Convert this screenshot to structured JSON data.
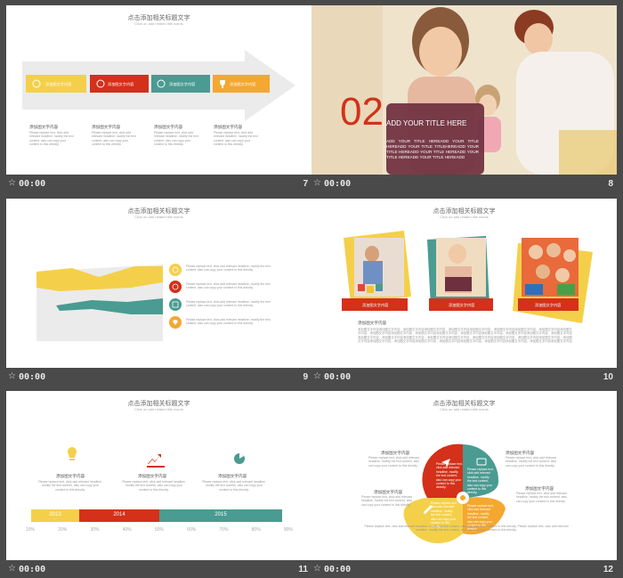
{
  "slides": [
    {
      "number": "7",
      "time": "00:00",
      "title": "点击添加相关标题文字",
      "subtitle": "Click on add related title words",
      "arrow_labels": [
        "添加图文字内容",
        "添加图文字内容",
        "添加图文字内容",
        "添加图文字内容"
      ],
      "captions": [
        "添加图文字内容",
        "添加图文字内容",
        "添加图文字内容",
        "添加图文字内容"
      ],
      "body": "Please replace text, click add relevant headline, modify the text content, also can copy your content to this directly."
    },
    {
      "number": "8",
      "time": "00:00",
      "big_number": "02",
      "heading": "ADD YOUR TITLE HERE",
      "body": "ADD YOUR TITLE HEREADD YOUR TITLE HEREADD YOUR TITLE TITLEHEREADD YOUR TITLE HEREADD YOUR TITLE HEREADD YOUR TITLE HEREADD YOUR TITLE HEREADD"
    },
    {
      "number": "9",
      "time": "00:00",
      "title": "点击添加相关标题文字",
      "subtitle": "Click on add related title words",
      "body": "Please replace text, click add relevant headline, modify the text content, also can copy your content to this directly."
    },
    {
      "number": "10",
      "time": "00:00",
      "title": "点击添加相关标题文字",
      "subtitle": "Click on add related title words",
      "photo_labels": [
        "添加图文字内容",
        "添加图文字内容",
        "添加图文字内容"
      ],
      "section_heading": "添加图文字内容",
      "body": "添加图文字内容添加图文字内容，添加图文字内容添加图文字内容，添加图文字内容添加图文字内容，添加图文字内容添加图文字内容，添加图文字内容添加图文字内容，添加图文字内容添加图文字内容，添加图文字内容添加图文字内容，添加图文字内容添加图文字内容，添加图文字内容添加图文字内容，添加图文字内容添加图文字内容，添加图文字内容添加图文字内容，添加图文字内容添加图文字内容，添加图文字内容添加图文字内容，添加图文字内容添加图文字内容，添加图文字内容添加图文字内容，添加图文字内容添加图文字内容，添加图文字内容添加图文字内容，添加图文字内容添加图文字内容，添加图文字内容添加图文字内容"
    },
    {
      "number": "11",
      "time": "00:00",
      "title": "点击添加相关标题文字",
      "subtitle": "Click on add related title words",
      "captions": [
        "添加图文字内容",
        "添加图文字内容",
        "添加图文字内容"
      ],
      "body": "Please replace text, click add relevant headline, modify the text content, also can copy your content to this directly.",
      "years": [
        "2013",
        "2014",
        "2015"
      ],
      "percents": [
        "10%",
        "20%",
        "30%",
        "40%",
        "50%",
        "60%",
        "70%",
        "80%",
        "90%"
      ],
      "year_share": [
        0.19,
        0.32,
        0.49
      ]
    },
    {
      "number": "12",
      "time": "00:00",
      "title": "点击添加相关标题文字",
      "subtitle": "Click on add related title words",
      "labels": [
        "添加图文字内容",
        "添加图文字内容",
        "添加图文字内容",
        "添加图文字内容"
      ],
      "body": "Please replace text, click add relevant headline, modify the text content, also can copy your content to this directly.",
      "bottom": "Please replace text, click add relevant headline, modify the text content, also can copy your content to this directly. Please replace text, click add relevant headline, modify the text content, also can copy your content to this directly."
    }
  ],
  "colors": {
    "yellow": "#f4d04a",
    "red": "#d4301a",
    "teal": "#4a9b91",
    "orange": "#f4a830",
    "grey": "#e6e6e6"
  },
  "icons": [
    "bulb-icon",
    "group-icon",
    "pie-icon",
    "trophy-icon",
    "paper-plane-icon",
    "camera-icon",
    "pencil-icon",
    "settings-icon",
    "chart-icon",
    "clock-icon",
    "heart-icon"
  ]
}
